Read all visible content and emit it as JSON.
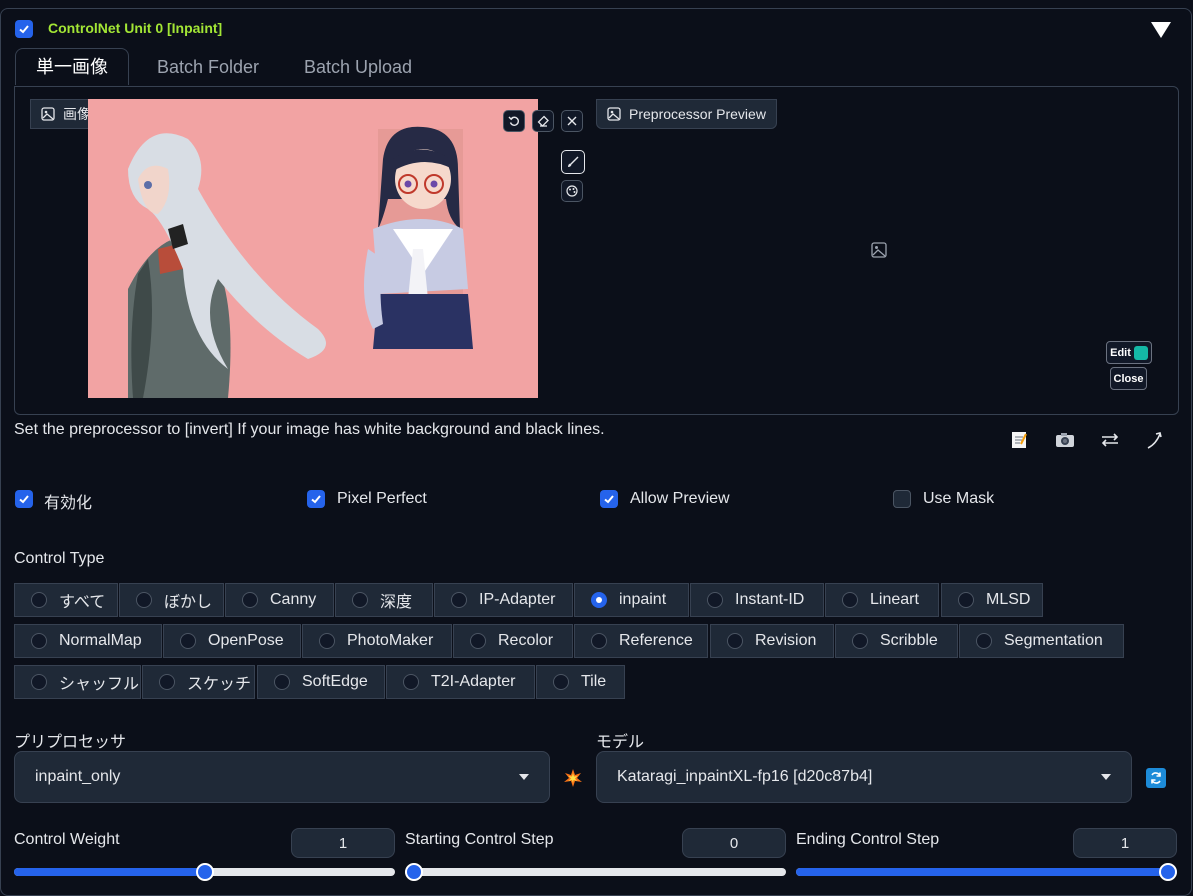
{
  "unit": {
    "title": "ControlNet Unit 0  [Inpaint]",
    "enabled": true
  },
  "tabs": [
    {
      "label": "単一画像",
      "active": true
    },
    {
      "label": "Batch Folder",
      "active": false
    },
    {
      "label": "Batch Upload",
      "active": false
    }
  ],
  "image_panel": {
    "label": "画像"
  },
  "preview_panel": {
    "label": "Preprocessor Preview",
    "edit_label": "Edit",
    "close_label": "Close"
  },
  "hint": "Set the preprocessor to [invert] If your image has white background and black lines.",
  "options": [
    {
      "label": "有効化",
      "checked": true
    },
    {
      "label": "Pixel Perfect",
      "checked": true
    },
    {
      "label": "Allow Preview",
      "checked": true
    },
    {
      "label": "Use Mask",
      "checked": false
    }
  ],
  "control_type": {
    "heading": "Control Type",
    "items": [
      "すべて",
      "ぼかし",
      "Canny",
      "深度",
      "IP-Adapter",
      "inpaint",
      "Instant-ID",
      "Lineart",
      "MLSD",
      "NormalMap",
      "OpenPose",
      "PhotoMaker",
      "Recolor",
      "Reference",
      "Revision",
      "Scribble",
      "Segmentation",
      "シャッフル",
      "スケッチ",
      "SoftEdge",
      "T2I-Adapter",
      "Tile"
    ],
    "selected": "inpaint"
  },
  "preprocessor": {
    "label": "プリプロセッサ",
    "value": "inpaint_only"
  },
  "model": {
    "label": "モデル",
    "value": "Kataragi_inpaintXL-fp16 [d20c87b4]"
  },
  "sliders": [
    {
      "label": "Control Weight",
      "value": "1",
      "fraction": 0.5
    },
    {
      "label": "Starting Control Step",
      "value": "0",
      "fraction": 0.0
    },
    {
      "label": "Ending Control Step",
      "value": "1",
      "fraction": 1.0
    }
  ],
  "colors": {
    "accent": "#2563eb",
    "unit_title": "#a3e635",
    "image_bg": "#f2a3a3"
  }
}
